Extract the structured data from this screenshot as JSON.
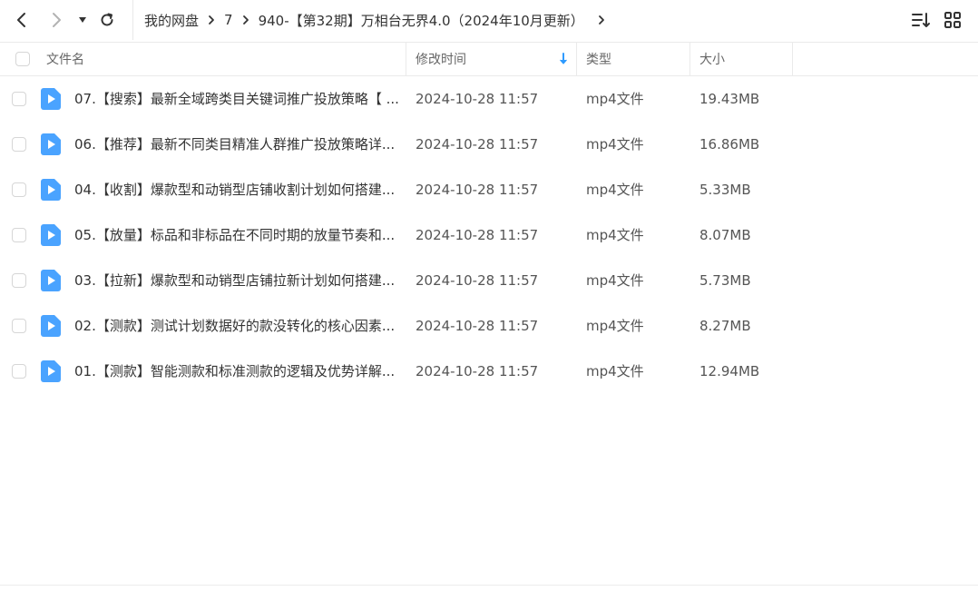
{
  "breadcrumb": {
    "items": [
      "我的网盘",
      "7",
      "940-【第32期】万相台无界4.0（2024年10月更新）"
    ]
  },
  "header": {
    "name_label": "文件名",
    "time_label": "修改时间",
    "type_label": "类型",
    "size_label": "大小"
  },
  "files": [
    {
      "name": "07.【搜索】最新全域跨类目关键词推广投放策略【 ...",
      "time": "2024-10-28 11:57",
      "type": "mp4文件",
      "size": "19.43MB"
    },
    {
      "name": "06.【推荐】最新不同类目精准人群推广投放策略详...",
      "time": "2024-10-28 11:57",
      "type": "mp4文件",
      "size": "16.86MB"
    },
    {
      "name": "04.【收割】爆款型和动销型店铺收割计划如何搭建...",
      "time": "2024-10-28 11:57",
      "type": "mp4文件",
      "size": "5.33MB"
    },
    {
      "name": "05.【放量】标品和非标品在不同时期的放量节奏和...",
      "time": "2024-10-28 11:57",
      "type": "mp4文件",
      "size": "8.07MB"
    },
    {
      "name": "03.【拉新】爆款型和动销型店铺拉新计划如何搭建...",
      "time": "2024-10-28 11:57",
      "type": "mp4文件",
      "size": "5.73MB"
    },
    {
      "name": "02.【测款】测试计划数据好的款没转化的核心因素...",
      "time": "2024-10-28 11:57",
      "type": "mp4文件",
      "size": "8.27MB"
    },
    {
      "name": "01.【测款】智能测款和标准测款的逻辑及优势详解...",
      "time": "2024-10-28 11:57",
      "type": "mp4文件",
      "size": "12.94MB"
    }
  ],
  "icons": {
    "back": "arrow-left-icon",
    "forward": "arrow-right-icon",
    "history": "dropdown-triangle-icon",
    "refresh": "refresh-icon",
    "sort": "sort-icon",
    "grid": "grid-view-icon",
    "file": "video-file-icon",
    "sort_indicator": "sort-desc-arrow-icon"
  },
  "colors": {
    "accent": "#2f9bff",
    "file_icon": "#4aa3ff"
  }
}
